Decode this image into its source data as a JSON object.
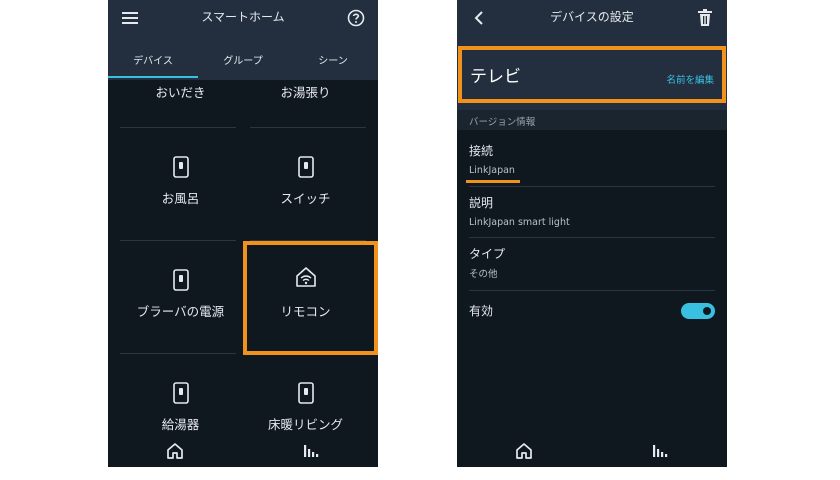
{
  "left_screen": {
    "title": "スマートホーム",
    "tabs": [
      "デバイス",
      "グループ",
      "シーン"
    ],
    "active_tab": 0,
    "devices": [
      {
        "label": "おいだき",
        "icon": "device-switch-icon"
      },
      {
        "label": "お湯張り",
        "icon": "device-switch-icon"
      },
      {
        "label": "お風呂",
        "icon": "device-switch-icon"
      },
      {
        "label": "スイッチ",
        "icon": "device-switch-icon"
      },
      {
        "label": "ブラーバの電源",
        "icon": "device-switch-icon"
      },
      {
        "label": "リモコン",
        "icon": "smart-home-wifi-icon"
      },
      {
        "label": "給湯器",
        "icon": "device-switch-icon"
      },
      {
        "label": "床暖リビング",
        "icon": "device-switch-icon"
      }
    ]
  },
  "right_screen": {
    "title": "デバイスの設定",
    "device_name": "テレビ",
    "edit_name_label": "名前を編集",
    "section_header": "バージョン情報",
    "rows": [
      {
        "label": "接続",
        "value": "LinkJapan"
      },
      {
        "label": "説明",
        "value": "LinkJapan smart light"
      },
      {
        "label": "タイプ",
        "value": "その他"
      }
    ],
    "enabled_label": "有効",
    "enabled": true
  },
  "colors": {
    "background": "#0f171f",
    "header": "#232f3e",
    "accent": "#39c0e0",
    "highlight": "#f0921b"
  }
}
